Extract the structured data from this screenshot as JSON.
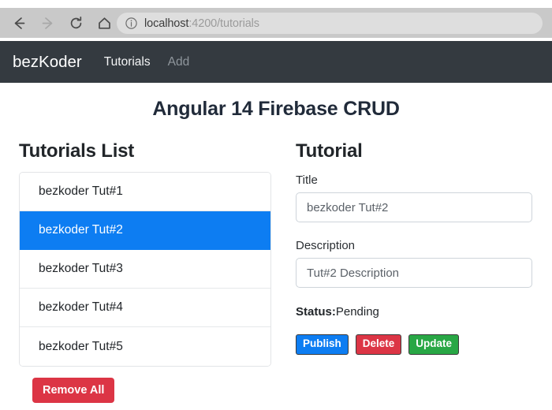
{
  "browser": {
    "back_icon": "arrow-left-icon",
    "forward_icon": "arrow-right-icon",
    "reload_icon": "reload-icon",
    "home_icon": "home-icon",
    "info_icon": "info-circle-icon",
    "url_host": "localhost",
    "url_path": ":4200/tutorials"
  },
  "navbar": {
    "brand": "bezKoder",
    "links": [
      {
        "label": "Tutorials",
        "state": "active"
      },
      {
        "label": "Add",
        "state": "muted"
      }
    ]
  },
  "page": {
    "title": "Angular 14 Firebase CRUD"
  },
  "list_panel": {
    "heading": "Tutorials List",
    "items": [
      {
        "label": "bezkoder Tut#1",
        "active": false
      },
      {
        "label": "bezkoder Tut#2",
        "active": true
      },
      {
        "label": "bezkoder Tut#3",
        "active": false
      },
      {
        "label": "bezkoder Tut#4",
        "active": false
      },
      {
        "label": "bezkoder Tut#5",
        "active": false
      }
    ],
    "remove_all_label": "Remove All"
  },
  "form_panel": {
    "heading": "Tutorial",
    "title_label": "Title",
    "title_value": "bezkoder Tut#2",
    "description_label": "Description",
    "description_value": "Tut#2 Description",
    "status_label": "Status:",
    "status_value": "Pending",
    "buttons": {
      "publish": "Publish",
      "delete": "Delete",
      "update": "Update"
    }
  },
  "colors": {
    "navbar_bg": "#343a40",
    "active_item_blue": "#0d7df2",
    "danger_red": "#dc3545",
    "success_green": "#28a745",
    "title_navy": "#212b3a"
  }
}
